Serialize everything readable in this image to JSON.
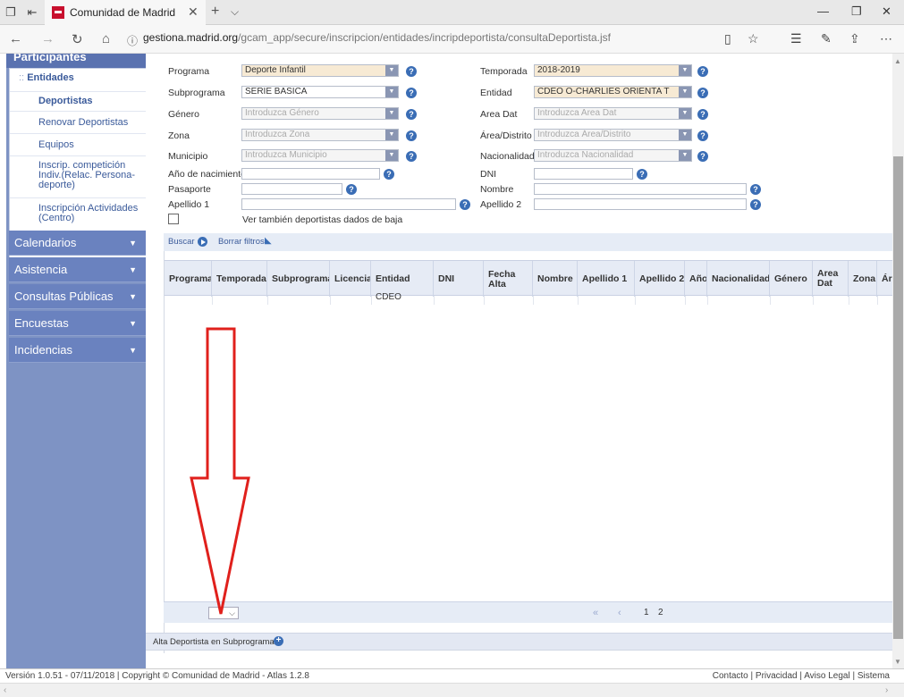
{
  "browser": {
    "tab_title": "Comunidad de Madrid",
    "url_host": "gestiona.madrid.org",
    "url_path": "/gcam_app/secure/inscripcion/entidades/incripdeportista/consultaDeportista.jsf"
  },
  "sidebar": {
    "header": "Participantes",
    "items": [
      {
        "label": "Entidades",
        "bullet": "::"
      },
      {
        "label": "Deportistas"
      },
      {
        "label": "Renovar Deportistas"
      },
      {
        "label": "Equipos"
      },
      {
        "label": "Inscrip. competición Indiv.(Relac. Persona-deporte)"
      },
      {
        "label": "Inscripción Actividades (Centro)"
      }
    ],
    "sections": [
      "Calendarios",
      "Asistencia",
      "Consultas Públicas",
      "Encuestas",
      "Incidencias"
    ]
  },
  "form": {
    "left": {
      "programa_label": "Programa",
      "programa_value": "Deporte Infantil",
      "subprograma_label": "Subprograma",
      "subprograma_value": "SERIE BASICA",
      "genero_label": "Género",
      "genero_placeholder": "Introduzca Género",
      "zona_label": "Zona",
      "zona_placeholder": "Introduzca Zona",
      "municipio_label": "Municipio",
      "municipio_placeholder": "Introduzca Municipio",
      "anio_label": "Año de nacimiento",
      "pasaporte_label": "Pasaporte",
      "apellido1_label": "Apellido 1",
      "baja_label": "Ver también deportistas dados de baja"
    },
    "right": {
      "temporada_label": "Temporada",
      "temporada_value": "2018-2019",
      "entidad_label": "Entidad",
      "entidad_value": "CDEO O-CHARLIES ORIENTA T",
      "areadat_label": "Area Dat",
      "areadat_placeholder": "Introduzca Area Dat",
      "distrito_label": "Área/Distrito",
      "distrito_placeholder": "Introduzca Área/Distrito",
      "nacionalidad_label": "Nacionalidad",
      "nacionalidad_placeholder": "Introduzca Nacionalidad",
      "dni_label": "DNI",
      "nombre_label": "Nombre",
      "apellido2_label": "Apellido 2"
    }
  },
  "toolbar": {
    "buscar": "Buscar",
    "borrar": "Borrar filtros"
  },
  "grid": {
    "columns": [
      "Programa",
      "Temporada",
      "Subprograma",
      "Licencia",
      "Entidad",
      "DNI",
      "Fecha Alta",
      "Nombre",
      "Apellido 1",
      "Apellido 2",
      "Año",
      "Nacionalidad",
      "Género",
      "Area Dat",
      "Zona",
      "Áre"
    ],
    "partial_row": {
      "entidad": "CDEO"
    }
  },
  "pager": {
    "first": "«",
    "prev": "‹",
    "pages": [
      "1",
      "2"
    ]
  },
  "alta_label": "Alta Deportista en Subprograma",
  "footer": {
    "left": "Versión 1.0.51 - 07/11/2018  |  Copyright © Comunidad de Madrid - Atlas 1.2.8",
    "right": "Contacto  |  Privacidad  |  Aviso Legal  |  Sistema"
  },
  "colors": {
    "sidebar_bg": "#7e93c4",
    "accent_blue": "#3a6db5",
    "filled_field": "#f7ead4",
    "arrow_red": "#e0201c"
  }
}
